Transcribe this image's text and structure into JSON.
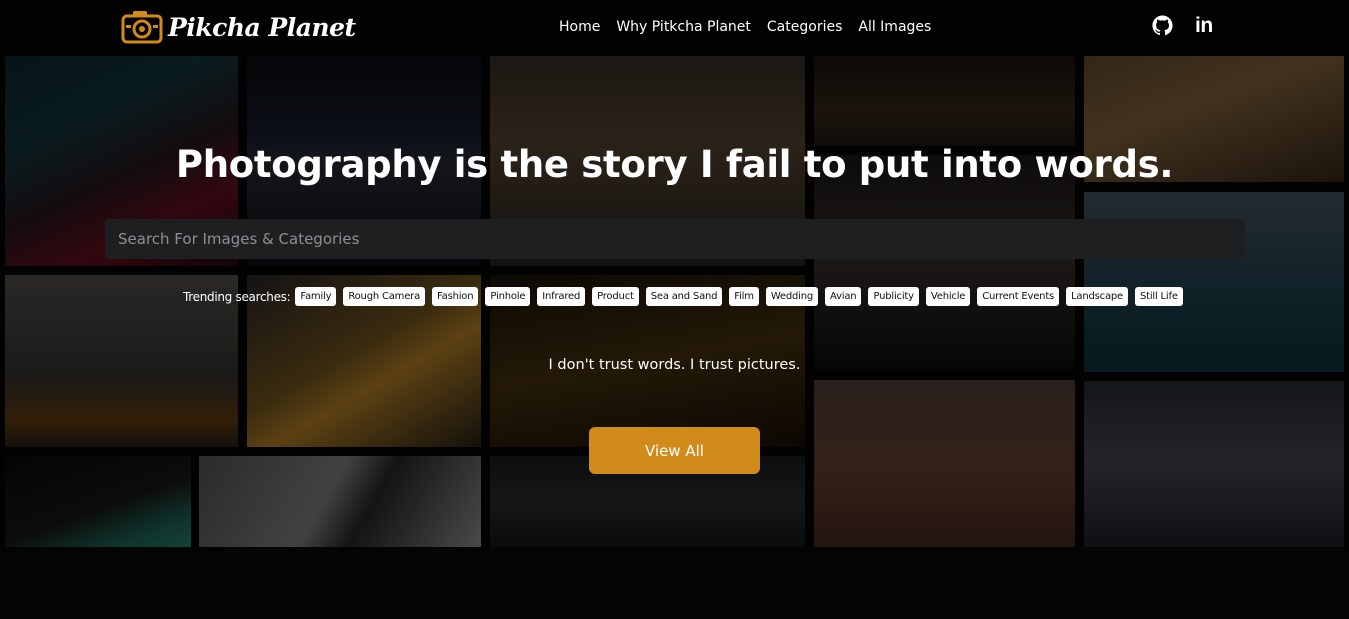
{
  "brand": {
    "name": "Pikcha Planet",
    "accent": "#d08b1b"
  },
  "nav": {
    "items": [
      {
        "label": "Home"
      },
      {
        "label": "Why Pitkcha Planet"
      },
      {
        "label": "Categories"
      },
      {
        "label": "All Images"
      }
    ]
  },
  "social": {
    "github_icon": "github-icon",
    "linkedin_text": "in"
  },
  "hero": {
    "title": "Photography is the story I fail to put into words.",
    "search_placeholder": "Search For Images & Categories",
    "trending_label": "Trending searches:",
    "trending": [
      "Family",
      "Rough Camera",
      "Fashion",
      "Pinhole",
      "Infrared",
      "Product",
      "Sea and Sand",
      "Film",
      "Wedding",
      "Avian",
      "Publicity",
      "Vehicle",
      "Current Events",
      "Landscape",
      "Still Life"
    ],
    "quote": "I don't trust words. I trust pictures.",
    "cta_label": "View All"
  }
}
